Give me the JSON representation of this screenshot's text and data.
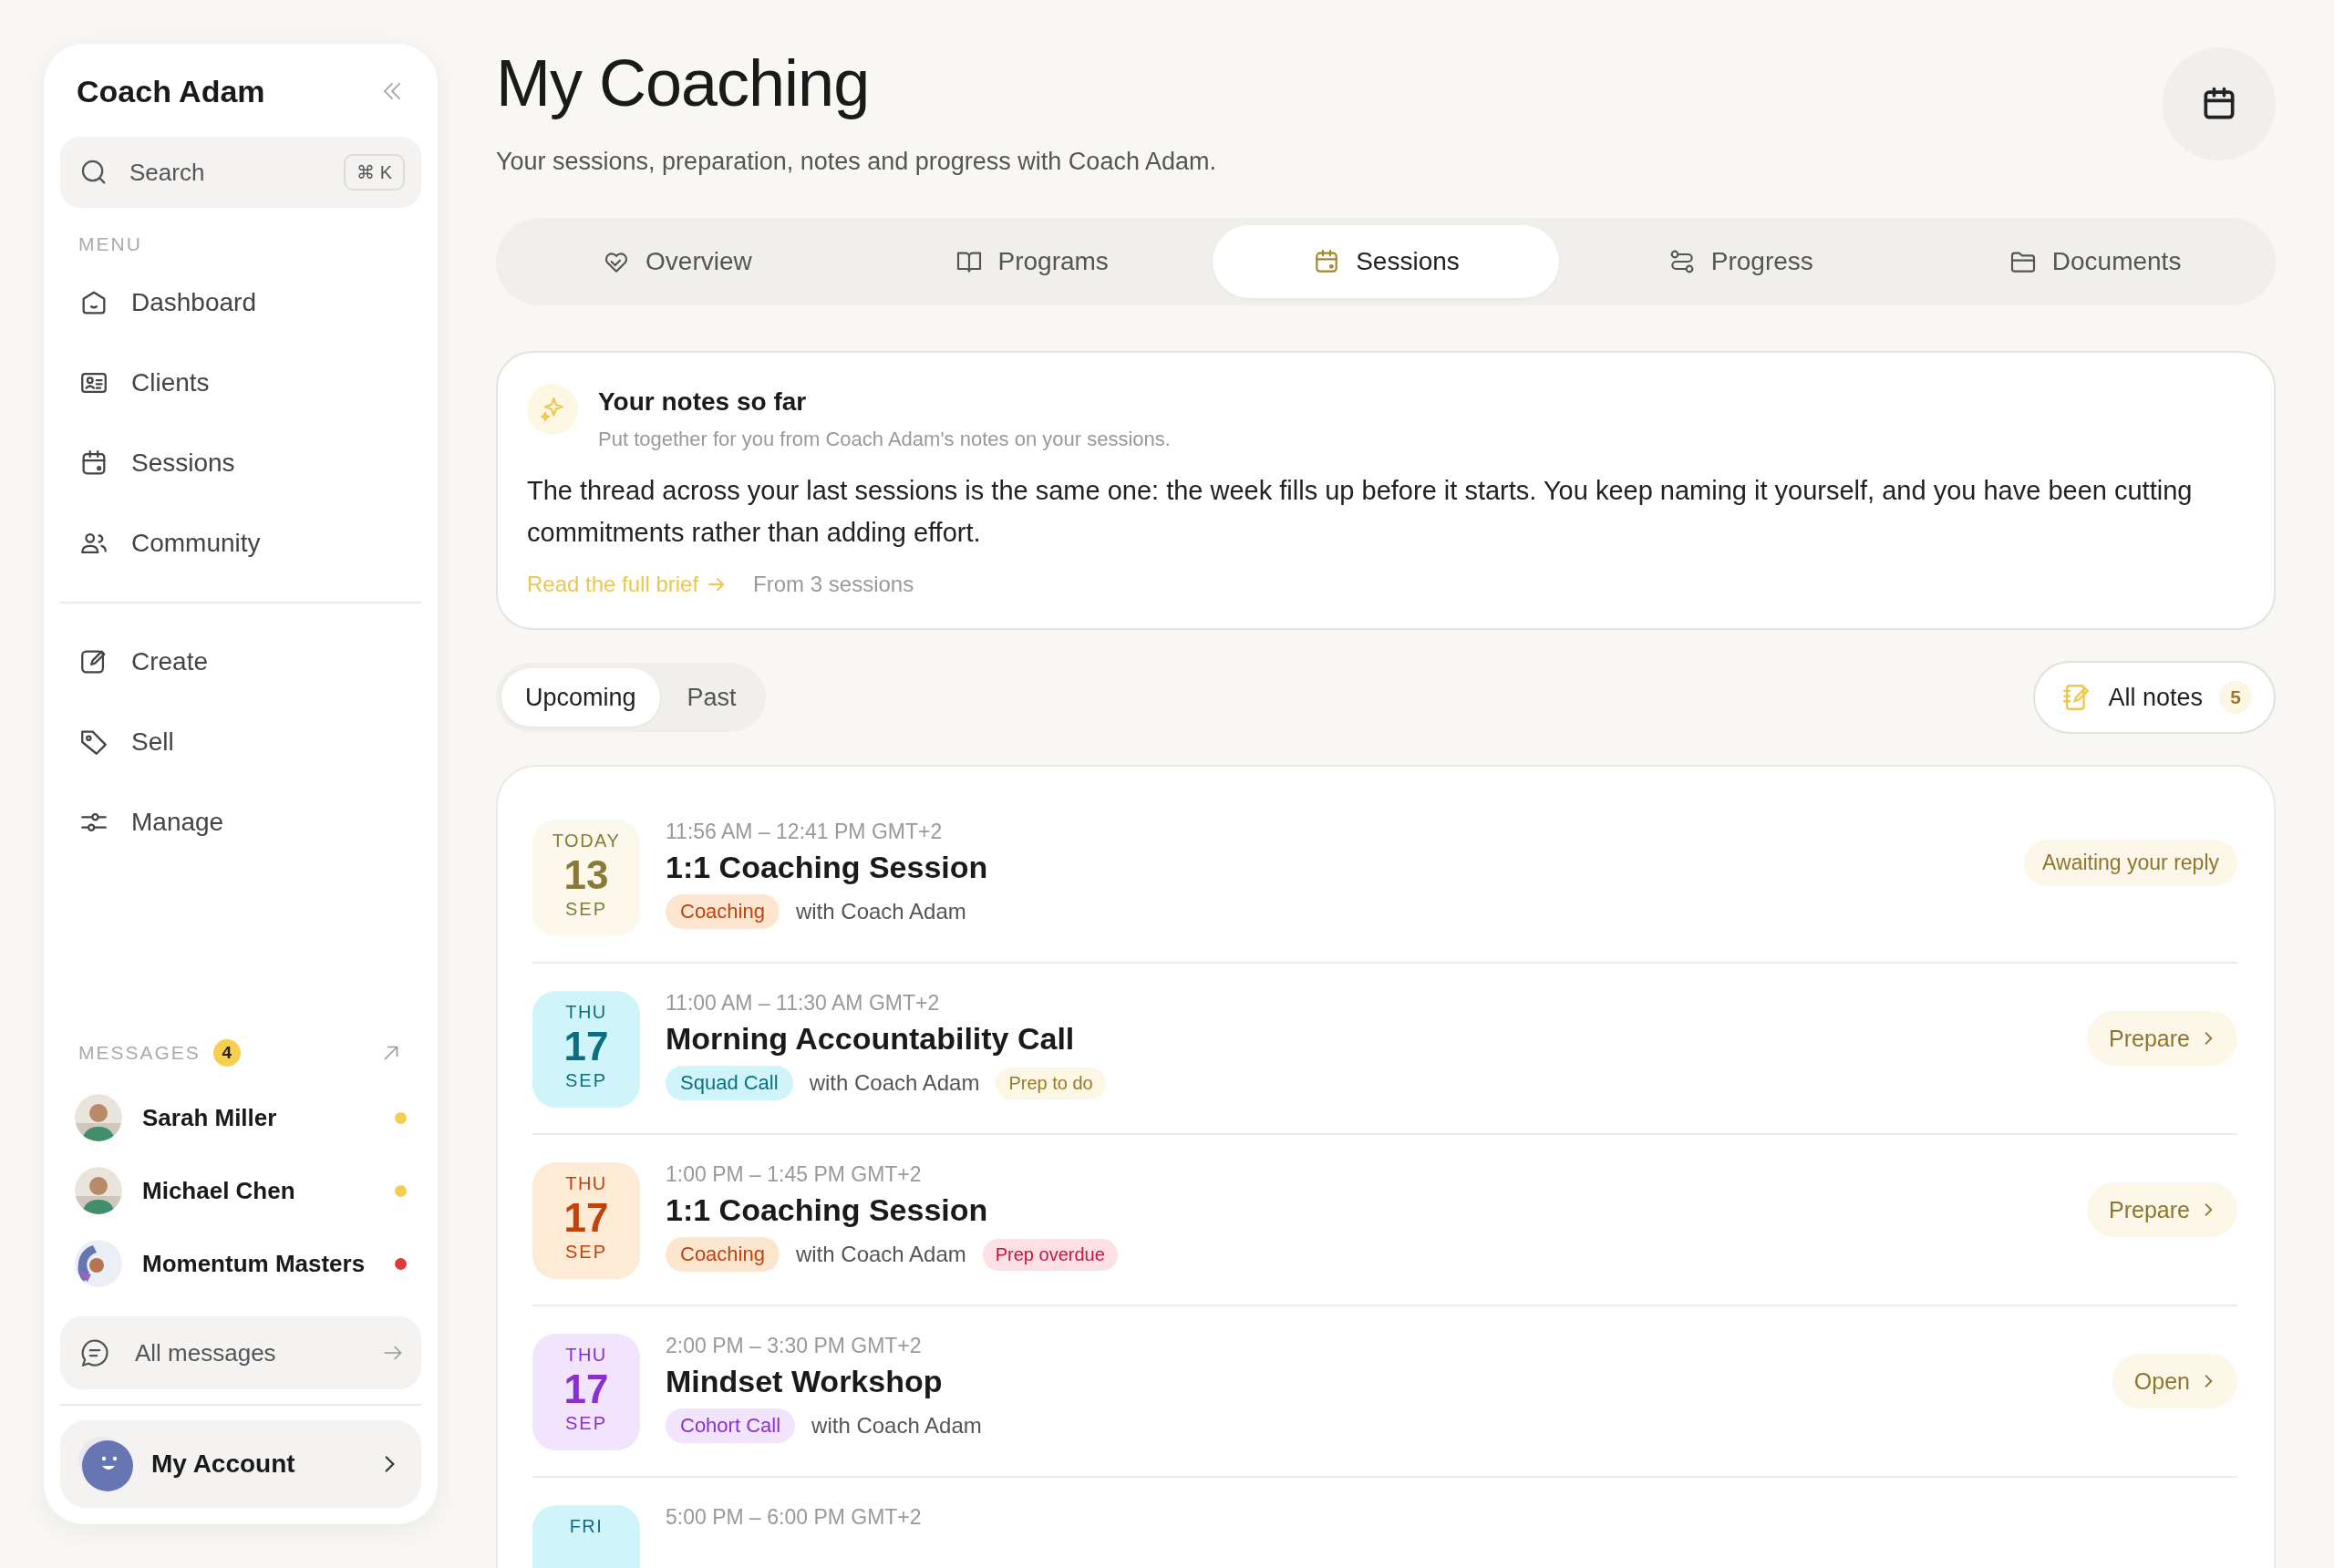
{
  "sidebar": {
    "title": "Coach Adam",
    "search": {
      "placeholder": "Search",
      "shortcut": "⌘ K"
    },
    "menu_label": "MENU",
    "menu": [
      {
        "label": "Dashboard"
      },
      {
        "label": "Clients"
      },
      {
        "label": "Sessions"
      },
      {
        "label": "Community"
      }
    ],
    "tools": [
      {
        "label": "Create"
      },
      {
        "label": "Sell"
      },
      {
        "label": "Manage"
      }
    ],
    "messages_label": "MESSAGES",
    "messages_count": "4",
    "messages": [
      {
        "name": "Sarah Miller",
        "color": "#f5cd55"
      },
      {
        "name": "Michael Chen",
        "color": "#f5cd55"
      },
      {
        "name": "Momentum Masters",
        "kind": "group",
        "color": "#e03b3b"
      }
    ],
    "all_messages": "All messages",
    "account": "My Account"
  },
  "header": {
    "title": "My Coaching",
    "subtitle": "Your sessions, preparation, notes and progress with Coach Adam."
  },
  "tabs": [
    {
      "label": "Overview",
      "selected": false
    },
    {
      "label": "Programs",
      "selected": false
    },
    {
      "label": "Sessions",
      "selected": true
    },
    {
      "label": "Progress",
      "selected": false
    },
    {
      "label": "Documents",
      "selected": false
    }
  ],
  "notes_card": {
    "title": "Your notes so far",
    "subtitle": "Put together for you from Coach Adam's notes on your sessions.",
    "body": "The thread across your last sessions is the same one: the week fills up before it starts. You keep naming it yourself, and you have been cutting commitments rather than adding effort.",
    "link": "Read the full brief",
    "source": "From 3 sessions"
  },
  "filters": [
    {
      "label": "Upcoming",
      "selected": true
    },
    {
      "label": "Past",
      "selected": false
    }
  ],
  "all_notes": {
    "label": "All notes",
    "count": "5"
  },
  "sessions": [
    {
      "weekday": "TODAY",
      "day": "13",
      "month": "SEP",
      "today": true,
      "kind": "coaching",
      "time": "11:56 AM – 12:41 PM GMT+2",
      "title": "1:1 Coaching Session",
      "tag": "Coaching",
      "with": "with Coach Adam",
      "action": {
        "kind": "status",
        "label": "Awaiting your reply"
      }
    },
    {
      "weekday": "THU",
      "day": "17",
      "month": "SEP",
      "today": false,
      "kind": "squad",
      "time": "11:00 AM – 11:30 AM GMT+2",
      "title": "Morning Accountability Call",
      "tag": "Squad Call",
      "with": "with Coach Adam",
      "prep": {
        "kind": "todo",
        "label": "Prep to do"
      },
      "action": {
        "kind": "button",
        "label": "Prepare"
      }
    },
    {
      "weekday": "THU",
      "day": "17",
      "month": "SEP",
      "today": false,
      "kind": "coaching",
      "time": "1:00 PM – 1:45 PM GMT+2",
      "title": "1:1 Coaching Session",
      "tag": "Coaching",
      "with": "with Coach Adam",
      "prep": {
        "kind": "overdue",
        "label": "Prep overdue"
      },
      "action": {
        "kind": "button",
        "label": "Prepare"
      }
    },
    {
      "weekday": "THU",
      "day": "17",
      "month": "SEP",
      "today": false,
      "kind": "cohort",
      "time": "2:00 PM – 3:30 PM GMT+2",
      "title": "Mindset Workshop",
      "tag": "Cohort Call",
      "with": "with Coach Adam",
      "action": {
        "kind": "button",
        "label": "Open"
      }
    },
    {
      "weekday": "FRI",
      "today": false,
      "kind": "squad",
      "time": "5:00 PM – 6:00 PM GMT+2"
    }
  ]
}
